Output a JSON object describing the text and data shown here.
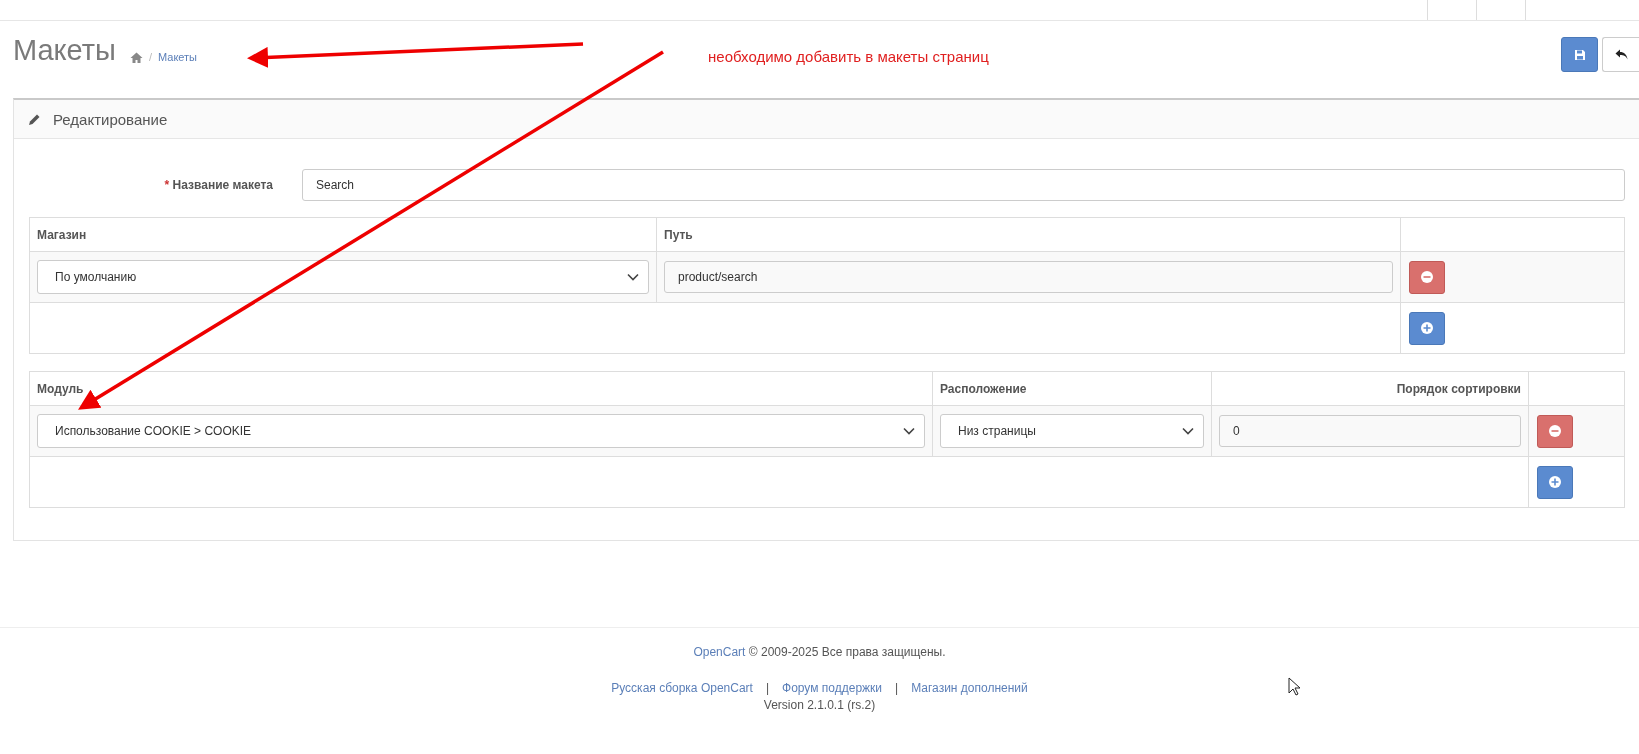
{
  "page_title": "Макеты",
  "breadcrumb": {
    "separator": "/",
    "items": [
      "Макеты"
    ]
  },
  "annotation": "необходимо добавить в макеты страниц",
  "panel_title": "Редактирование",
  "layout_name": {
    "required_mark": "*",
    "label": "Название макета",
    "value": "Search"
  },
  "routes_table": {
    "columns": [
      "Магазин",
      "Путь"
    ],
    "rows": [
      {
        "store": "По умолчанию",
        "route": "product/search"
      }
    ]
  },
  "modules_table": {
    "columns": [
      "Модуль",
      "Расположение",
      "Порядок сортировки"
    ],
    "rows": [
      {
        "module": "Использование COOKIE > COOKIE",
        "position": "Низ страницы",
        "sort_order": "0"
      }
    ]
  },
  "footer": {
    "brand_link": "OpenCart",
    "copyright": "© 2009-2025 Все права защищены.",
    "links_line": [
      {
        "kind": "link",
        "text": "Русская сборка OpenCart"
      },
      {
        "kind": "separator",
        "text": "|"
      },
      {
        "kind": "link",
        "text": "Форум поддержки"
      },
      {
        "kind": "separator",
        "text": "|"
      },
      {
        "kind": "link",
        "text": "Магазин дополнений"
      }
    ],
    "version": "Version 2.1.0.1 (rs.2)"
  }
}
